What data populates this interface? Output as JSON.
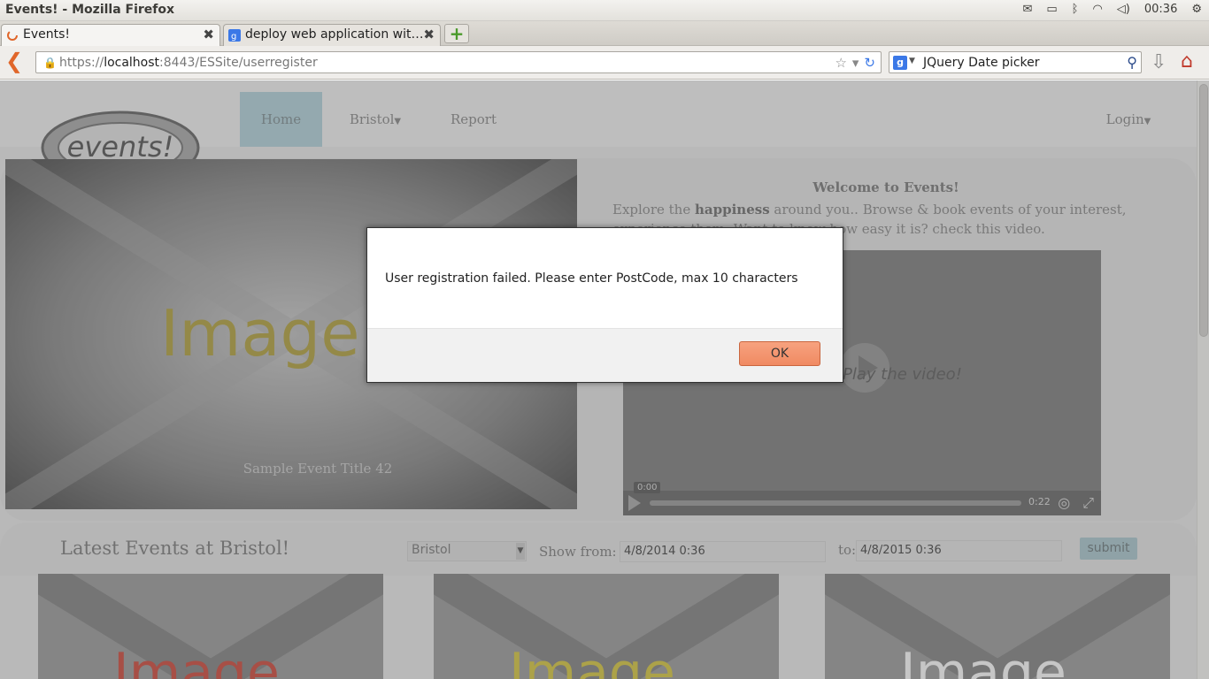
{
  "os": {
    "window_title": "Events! - Mozilla Firefox",
    "clock": "00:36"
  },
  "browser": {
    "tabs": [
      {
        "label": "Events!",
        "active": true
      },
      {
        "label": "deploy web application wit…",
        "active": false
      }
    ],
    "url_prefix": "https://",
    "url_host": "localhost",
    "url_rest": ":8443/ESSite/userregister",
    "search_value": "JQuery Date picker"
  },
  "site": {
    "logo_text": "events!",
    "nav": {
      "home": "Home",
      "bristol": "Bristol",
      "report": "Report",
      "login": "Login"
    },
    "hero": {
      "image_text": "Image",
      "caption": "Sample Event Title 42"
    },
    "welcome": {
      "title": "Welcome to Events!",
      "text_before": "Explore the ",
      "text_bold": "happiness",
      "text_after": " around you.. Browse & book events of your interest, experience them. Want to know how easy it is? check this video."
    },
    "video": {
      "overlay_text": "Play the video!",
      "current_time": "0:00",
      "duration": "0:22"
    },
    "latest": {
      "title": "Latest Events at Bristol!",
      "city": "Bristol",
      "show_from_label": "Show from:",
      "from_value": "4/8/2014 0:36",
      "to_label": "to:",
      "to_value": "4/8/2015 0:36",
      "submit": "submit"
    },
    "thumb_colors": [
      "#c0392b",
      "#c8b830",
      "#f0f0f0"
    ]
  },
  "dialog": {
    "message": "User registration failed.  Please enter PostCode, max 10 characters",
    "ok": "OK"
  }
}
